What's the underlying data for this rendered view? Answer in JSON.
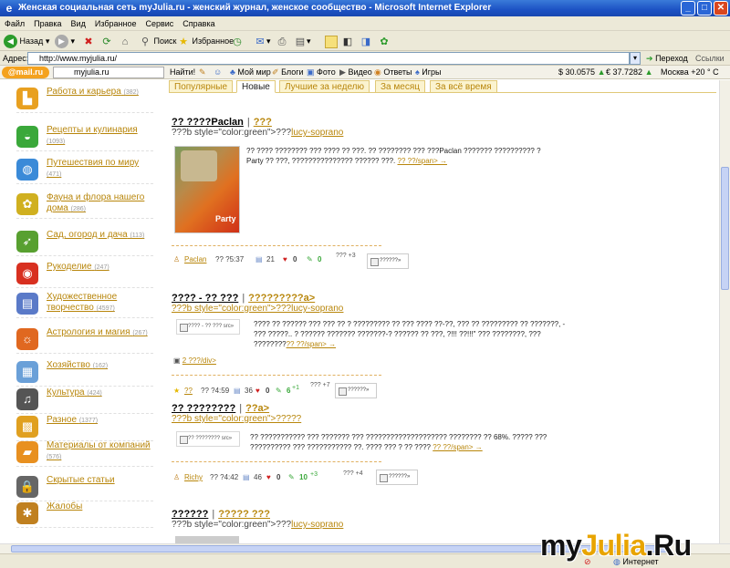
{
  "window": {
    "title": "Женская социальная сеть myJulia.ru - женский журнал, женское сообщество - Microsoft Internet Explorer"
  },
  "menu": [
    "Файл",
    "Правка",
    "Вид",
    "Избранное",
    "Сервис",
    "Справка"
  ],
  "toolbar": {
    "back": "Назад",
    "search": "Поиск",
    "favorites": "Избранное"
  },
  "address": {
    "label": "Адрес:",
    "value": "http://www.myjulia.ru/",
    "go": "Переход",
    "links": "Ссылки"
  },
  "mailbar": {
    "logo": "@mail.ru",
    "site": "myjulia.ru",
    "find": "Найти!",
    "items": [
      "Мой мир",
      "Блоги",
      "Фото",
      "Видео",
      "Ответы",
      "Игры"
    ],
    "usd": "$ 30.0575",
    "eur": "€ 37.7282",
    "weather": "Москва +20 ° C"
  },
  "categories": [
    {
      "label": "Работа и карьера",
      "count": "(382)",
      "icon": "briefcase-chair-icon",
      "color": "#e8a020"
    },
    {
      "label": "Рецепты и кулинария",
      "count": "(1093)",
      "icon": "pot-icon",
      "color": "#3aa83a"
    },
    {
      "label": "Путешествия по миру",
      "count": "(471)",
      "icon": "globe-icon",
      "color": "#3a8ad8"
    },
    {
      "label": "Фауна и флора нашего дома",
      "count": "(286)",
      "icon": "flower-icon",
      "color": "#d0b020"
    },
    {
      "label": "Сад, огород и дача",
      "count": "(113)",
      "icon": "carrot-icon",
      "color": "#58a030"
    },
    {
      "label": "Рукоделие",
      "count": "(247)",
      "icon": "yarn-icon",
      "color": "#d83020"
    },
    {
      "label": "Художественное творчество",
      "count": "(4597)",
      "icon": "books-icon",
      "color": "#5a7ac8"
    },
    {
      "label": "Астрология и магия",
      "count": "(267)",
      "icon": "sun-icon",
      "color": "#e06820"
    },
    {
      "label": "Хозяйство",
      "count": "(162)",
      "icon": "window-icon",
      "color": "#6aa0d8"
    },
    {
      "label": "Культура",
      "count": "(424)",
      "icon": "music-icon",
      "color": "#555555"
    },
    {
      "label": "Разное",
      "count": "(1377)",
      "icon": "blocks-icon",
      "color": "#e0a020"
    },
    {
      "label": "Материалы от компаний",
      "count": "(576)",
      "icon": "folder-icon",
      "color": "#e89020"
    },
    {
      "label": "Скрытые статьи",
      "count": "",
      "icon": "lock-icon",
      "color": "#666666"
    },
    {
      "label": "Жалобы",
      "count": "",
      "icon": "bug-icon",
      "color": "#c08020"
    }
  ],
  "tabs": [
    "Популярные",
    "Новые",
    "Лучшие за неделю",
    "За месяц",
    "За всё время"
  ],
  "posts": [
    {
      "title": "?? ????Paclan",
      "section": "???",
      "author_prefix": "???b style=\"color:green\">???",
      "author": "lucy-soprano",
      "body": "?? ???? ???????? ??? ???? ?? ???. ?? ???????? ??? ???Paclan ??????? ?????????? ? Party ?? ???, ??????????????? ?????? ???.",
      "more": "?? ??/span> →",
      "user": "Paclan",
      "time": "?? ?5:37",
      "views": "21",
      "likes": "0",
      "comments": "0",
      "rate": "??? +3",
      "box": "??????»"
    },
    {
      "title": "???? - ?? ???",
      "section": "?????????a>",
      "author_prefix": "???b style=\"color:green\">???",
      "author": "lucy-soprano",
      "body": "???? ?? ?????? ??? ??? ?? ? ????????? ?? ??? ???? ??-??, ??? ?? ????????? ?? ???????, - ??? ?????.. ? ?????? ??????? ???????-? ?????? ?? ???, ?!!! ??!!!\" ??? ????????, ??? ????????",
      "more": "?? ??/span> →",
      "thumb": "???? - ?? ??? src»",
      "extra": "2 ???/div>",
      "user": "??",
      "time": "?? ?4:59",
      "views": "36",
      "likes": "0",
      "comments": "6",
      "comments_plus": "+1",
      "rate": "??? +7",
      "box": "??????»"
    },
    {
      "title": "?? ????????",
      "section": "??a>",
      "author_prefix": "???b style=\"color:green\">?????",
      "author": "",
      "body": "?? ??????????? ??? ??????? ??? ???????????????????? ???????? ?? 68%. ????? ??? ?????????? ??? ??????????? ??. ???? ??? ? ?? ????",
      "more": "?? ??/span> →",
      "thumb": "?? ???????? src»",
      "user": "Richy",
      "time": "?? ?4:42",
      "views": "46",
      "likes": "0",
      "comments": "10",
      "comments_plus": "+3",
      "rate": "??? +4",
      "box": "??????»"
    },
    {
      "title": "??????",
      "section": "????? ???",
      "author_prefix": "???b style=\"color:green\">???",
      "author": "lucy-soprano"
    }
  ],
  "status": {
    "text": "Интернет"
  },
  "watermark": {
    "a": "my",
    "b": "Julia",
    ".ru": ".Ru"
  }
}
